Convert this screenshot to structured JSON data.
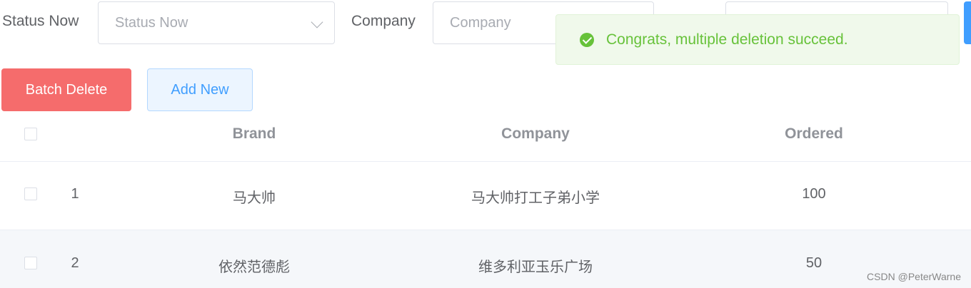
{
  "filters": {
    "status_label": "Status Now",
    "status_placeholder": "Status Now",
    "company_label": "Company",
    "company_placeholder": "Company"
  },
  "buttons": {
    "batch_delete": "Batch Delete",
    "add_new": "Add New"
  },
  "toast": {
    "message": "Congrats, multiple deletion succeed.",
    "color": "#67c23a"
  },
  "table": {
    "headers": [
      "Brand",
      "Company",
      "Ordered"
    ],
    "rows": [
      {
        "index": "1",
        "brand": "马大帅",
        "company": "马大帅打工子弟小学",
        "ordered": "100"
      },
      {
        "index": "2",
        "brand": "依然范德彪",
        "company": "维多利亚玉乐广场",
        "ordered": "50"
      }
    ]
  },
  "watermark": "CSDN @PeterWarne",
  "colors": {
    "danger": "#f56c6c",
    "primary": "#409eff",
    "row_stripe": "#f5f7fa"
  }
}
